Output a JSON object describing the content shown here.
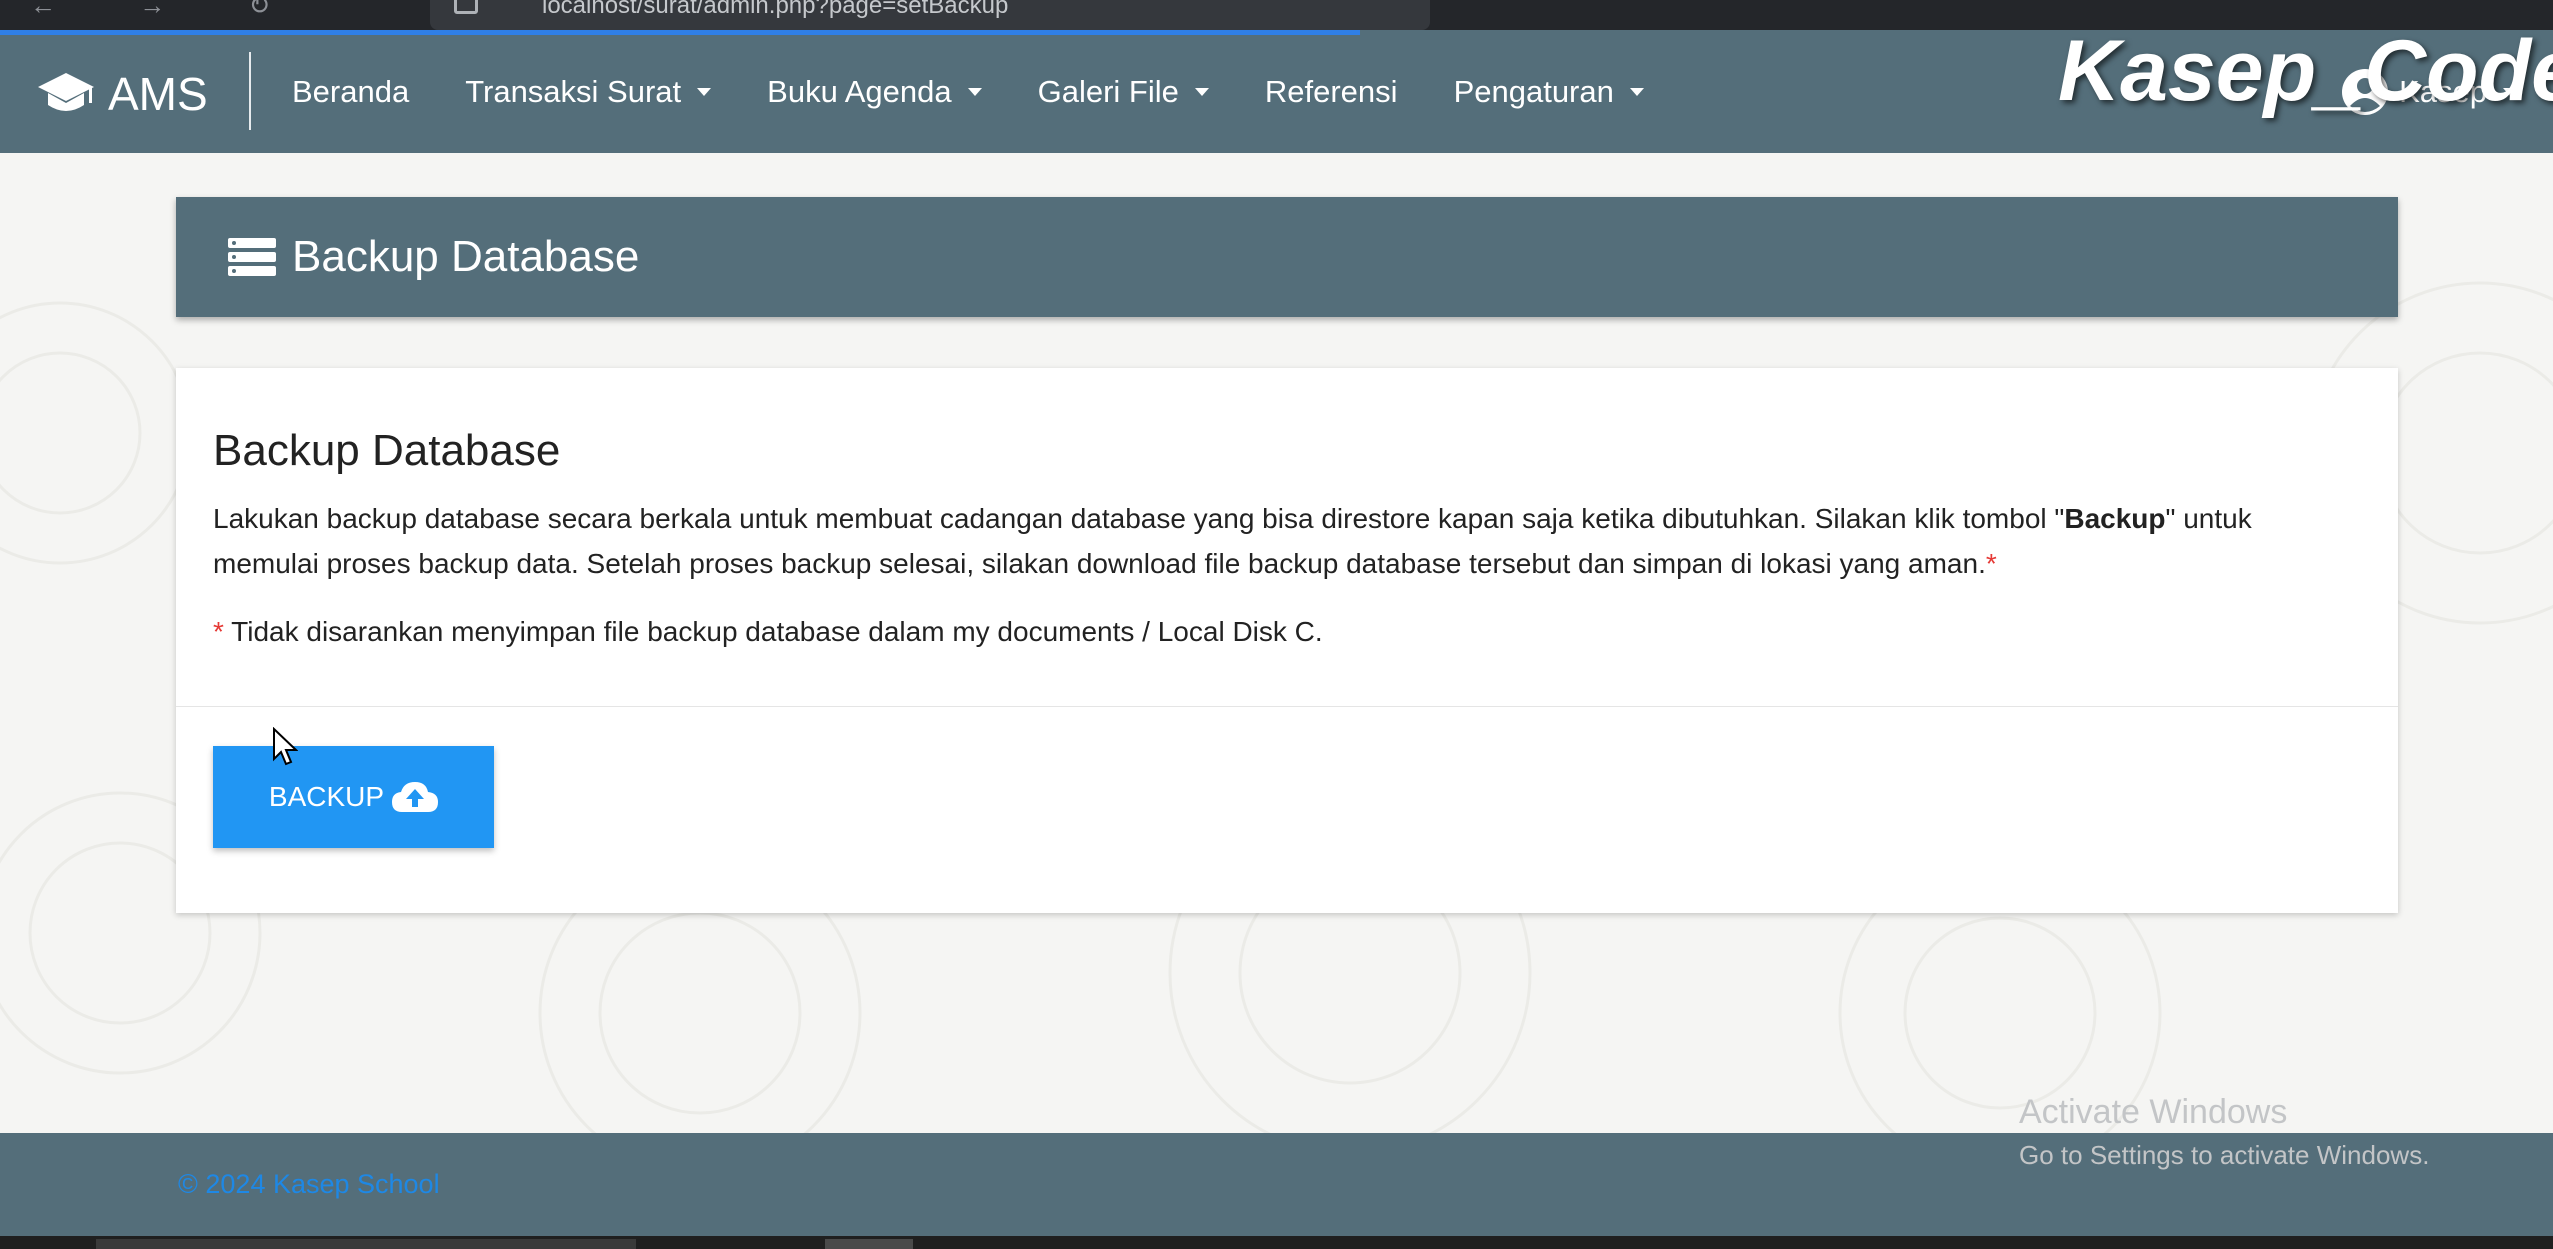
{
  "browser": {
    "url": "localhost/surat/admin.php?page=setBackup",
    "nav_glyphs": "← → ↻"
  },
  "navbar": {
    "brand": "AMS",
    "menu": [
      {
        "label": "Beranda",
        "dropdown": false
      },
      {
        "label": "Transaksi Surat",
        "dropdown": true
      },
      {
        "label": "Buku Agenda",
        "dropdown": true
      },
      {
        "label": "Galeri File",
        "dropdown": true
      },
      {
        "label": "Referensi",
        "dropdown": false
      },
      {
        "label": "Pengaturan",
        "dropdown": true
      }
    ],
    "user": "Kasep",
    "watermark": "Kasep_Code"
  },
  "page_header": {
    "title": "Backup Database",
    "icon": "database-list-icon"
  },
  "card": {
    "heading": "Backup Database",
    "desc_part1": "Lakukan backup database secara berkala untuk membuat cadangan database yang bisa direstore kapan saja ketika dibutuhkan. Silakan klik tombol \"",
    "desc_bold": "Backup",
    "desc_part2": "\" untuk memulai proses backup data. Setelah proses backup selesai, silakan download file backup database tersebut dan simpan di lokasi yang aman.",
    "asterisk": "*",
    "note": " Tidak disarankan menyimpan file backup database dalam my documents / Local Disk C.",
    "button_label": "BACKUP"
  },
  "footer": {
    "copyright": "© 2024 Kasep School"
  },
  "os_overlay": {
    "line1": "Activate Windows",
    "line2": "Go to Settings to activate Windows."
  },
  "colors": {
    "primary": "#546e7a",
    "accent": "#2196f3",
    "required": "#e53935"
  }
}
